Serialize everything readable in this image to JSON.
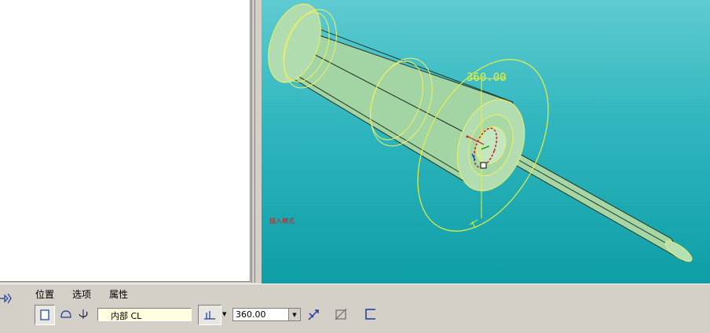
{
  "viewport": {
    "angle_dimension": "360.00",
    "mode_text": "插入模式"
  },
  "dashboard": {
    "tabs": [
      {
        "label": "位置"
      },
      {
        "label": "选项"
      },
      {
        "label": "属性"
      }
    ],
    "axis_field": "内部 CL",
    "angle_combo": "360.00",
    "combo_arrow": "▼"
  },
  "colors": {
    "viewport_top": "#5ecbd1",
    "viewport_bottom": "#0e9ea6",
    "model_fill": "#a8d8a8",
    "dimension_yellow": "#e8f040",
    "input_field_bg": "#ffffe0"
  }
}
